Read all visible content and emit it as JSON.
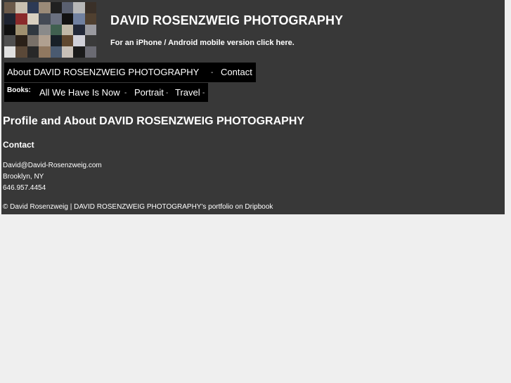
{
  "header": {
    "title": "DAVID ROSENZWEIG PHOTOGRAPHY",
    "mobile_link": "For an iPhone / Android mobile version click here."
  },
  "nav": {
    "about": "About DAVID ROSENZWEIG PHOTOGRAPHY",
    "contact": "Contact",
    "separator": "-",
    "books_label": "Books:",
    "books": [
      "All We Have Is Now",
      "Portrait",
      "Travel"
    ]
  },
  "main": {
    "heading": "Profile and About DAVID ROSENZWEIG PHOTOGRAPHY",
    "subheading": "Contact",
    "email": "David@David-Rosenzweig.com",
    "location": "Brooklyn, NY",
    "phone": "646.957.4454"
  },
  "footer": {
    "copyright": "© David Rosenzweig",
    "divider": "|",
    "portfolio_link": "DAVID ROSENZWEIG PHOTOGRAPHY's portfolio on Dripbook"
  }
}
